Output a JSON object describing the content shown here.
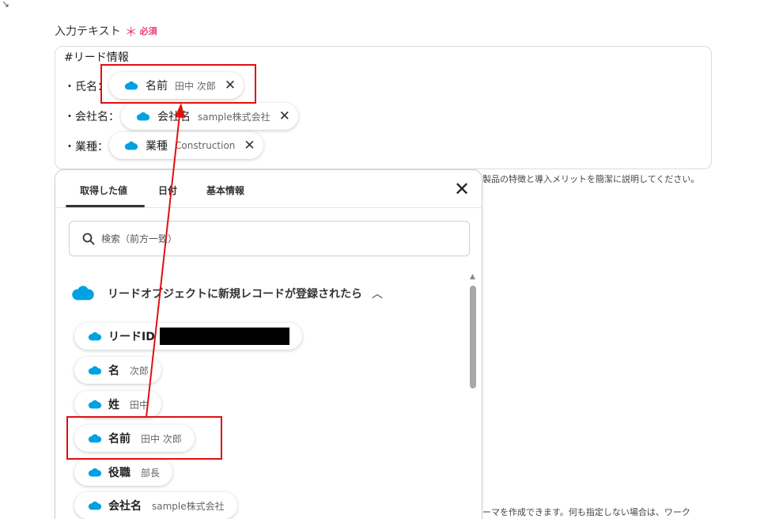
{
  "field": {
    "label": "入力テキスト",
    "star": "＊",
    "required": "必須"
  },
  "textarea": {
    "heading": "#リード情報",
    "lines": [
      {
        "label": "・氏名：",
        "pill_name": "名前",
        "pill_value": "田中 次郎"
      },
      {
        "label": "・会社名：",
        "pill_name": "会社名",
        "pill_value": "sample株式会社"
      },
      {
        "label": "・業種：",
        "pill_name": "業種",
        "pill_value": "Construction"
      }
    ]
  },
  "help": {
    "line1": "製品の特徴と導入メリットを簡潔に説明してください。",
    "line2": "ーマを作成できます。何も指定しない場合は、ワーク"
  },
  "panel": {
    "tabs": [
      "取得した値",
      "日付",
      "基本情報"
    ],
    "close": "✕",
    "search_placeholder": "検索（前方一致）",
    "section": "リードオブジェクトに新規レコードが登録されたら",
    "items": [
      {
        "name": "リードID",
        "value": ""
      },
      {
        "name": "名",
        "value": "次郎"
      },
      {
        "name": "姓",
        "value": "田中"
      },
      {
        "name": "名前",
        "value": "田中 次郎"
      },
      {
        "name": "役職",
        "value": "部長"
      },
      {
        "name": "会社名",
        "value": "sample株式会社"
      }
    ]
  },
  "colors": {
    "salesforce_blue": "#00a1e0",
    "highlight_red": "#e01010",
    "required_pink": "#e5406f"
  },
  "icons": {
    "brand": "salesforce-cloud-icon",
    "remove": "close-icon",
    "search": "search-icon",
    "collapse": "chevron-up-icon"
  }
}
